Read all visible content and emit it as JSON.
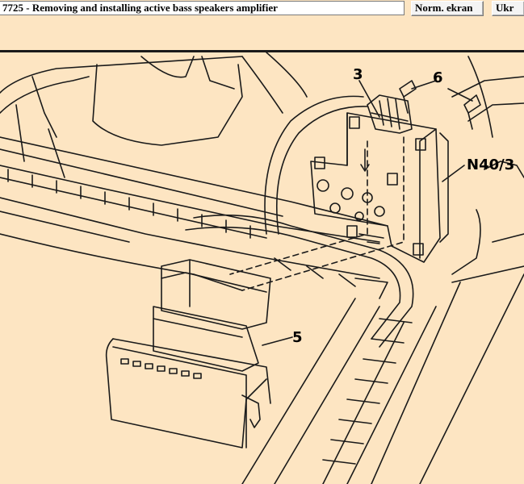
{
  "window": {
    "title": "7725 - Removing and installing active bass speakers amplifier",
    "buttons": [
      {
        "label": "Norm. ekran"
      },
      {
        "label": "Ukr"
      }
    ]
  },
  "illustration": {
    "callouts": [
      "3",
      "6",
      "N40/3",
      "5"
    ]
  },
  "colors": {
    "background": "#fde5c2",
    "line": "#1a1a1a"
  }
}
